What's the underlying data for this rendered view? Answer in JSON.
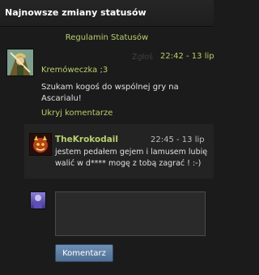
{
  "header": {
    "title": "Najnowsze zmiany statusów"
  },
  "rules_link": "Regulamin Statusów",
  "post": {
    "report_label": "Zgłoś",
    "time": "22:42 - 13 lip",
    "author": "Kremóweczka ;3",
    "text": "Szukam kogoś do wspólnej gry na Ascarialu!",
    "hide_comments_label": "Ukryj komentarze"
  },
  "comment": {
    "author": "TheKrokodail",
    "time": "22:45 - 13 lip",
    "text": "jestem pedałem gejem i lamusem lubię walić w d**** mogę z tobą zagrać ! :-)"
  },
  "reply": {
    "input_value": "",
    "submit_label": "Komentarz"
  }
}
